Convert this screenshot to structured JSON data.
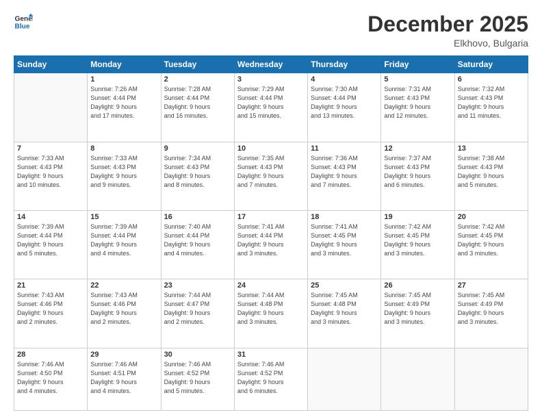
{
  "header": {
    "logo_line1": "General",
    "logo_line2": "Blue",
    "month": "December 2025",
    "location": "Elkhovo, Bulgaria"
  },
  "weekdays": [
    "Sunday",
    "Monday",
    "Tuesday",
    "Wednesday",
    "Thursday",
    "Friday",
    "Saturday"
  ],
  "weeks": [
    [
      {
        "day": "",
        "text": ""
      },
      {
        "day": "1",
        "text": "Sunrise: 7:26 AM\nSunset: 4:44 PM\nDaylight: 9 hours\nand 17 minutes."
      },
      {
        "day": "2",
        "text": "Sunrise: 7:28 AM\nSunset: 4:44 PM\nDaylight: 9 hours\nand 16 minutes."
      },
      {
        "day": "3",
        "text": "Sunrise: 7:29 AM\nSunset: 4:44 PM\nDaylight: 9 hours\nand 15 minutes."
      },
      {
        "day": "4",
        "text": "Sunrise: 7:30 AM\nSunset: 4:44 PM\nDaylight: 9 hours\nand 13 minutes."
      },
      {
        "day": "5",
        "text": "Sunrise: 7:31 AM\nSunset: 4:43 PM\nDaylight: 9 hours\nand 12 minutes."
      },
      {
        "day": "6",
        "text": "Sunrise: 7:32 AM\nSunset: 4:43 PM\nDaylight: 9 hours\nand 11 minutes."
      }
    ],
    [
      {
        "day": "7",
        "text": "Sunrise: 7:33 AM\nSunset: 4:43 PM\nDaylight: 9 hours\nand 10 minutes."
      },
      {
        "day": "8",
        "text": "Sunrise: 7:33 AM\nSunset: 4:43 PM\nDaylight: 9 hours\nand 9 minutes."
      },
      {
        "day": "9",
        "text": "Sunrise: 7:34 AM\nSunset: 4:43 PM\nDaylight: 9 hours\nand 8 minutes."
      },
      {
        "day": "10",
        "text": "Sunrise: 7:35 AM\nSunset: 4:43 PM\nDaylight: 9 hours\nand 7 minutes."
      },
      {
        "day": "11",
        "text": "Sunrise: 7:36 AM\nSunset: 4:43 PM\nDaylight: 9 hours\nand 7 minutes."
      },
      {
        "day": "12",
        "text": "Sunrise: 7:37 AM\nSunset: 4:43 PM\nDaylight: 9 hours\nand 6 minutes."
      },
      {
        "day": "13",
        "text": "Sunrise: 7:38 AM\nSunset: 4:43 PM\nDaylight: 9 hours\nand 5 minutes."
      }
    ],
    [
      {
        "day": "14",
        "text": "Sunrise: 7:39 AM\nSunset: 4:44 PM\nDaylight: 9 hours\nand 5 minutes."
      },
      {
        "day": "15",
        "text": "Sunrise: 7:39 AM\nSunset: 4:44 PM\nDaylight: 9 hours\nand 4 minutes."
      },
      {
        "day": "16",
        "text": "Sunrise: 7:40 AM\nSunset: 4:44 PM\nDaylight: 9 hours\nand 4 minutes."
      },
      {
        "day": "17",
        "text": "Sunrise: 7:41 AM\nSunset: 4:44 PM\nDaylight: 9 hours\nand 3 minutes."
      },
      {
        "day": "18",
        "text": "Sunrise: 7:41 AM\nSunset: 4:45 PM\nDaylight: 9 hours\nand 3 minutes."
      },
      {
        "day": "19",
        "text": "Sunrise: 7:42 AM\nSunset: 4:45 PM\nDaylight: 9 hours\nand 3 minutes."
      },
      {
        "day": "20",
        "text": "Sunrise: 7:42 AM\nSunset: 4:45 PM\nDaylight: 9 hours\nand 3 minutes."
      }
    ],
    [
      {
        "day": "21",
        "text": "Sunrise: 7:43 AM\nSunset: 4:46 PM\nDaylight: 9 hours\nand 2 minutes."
      },
      {
        "day": "22",
        "text": "Sunrise: 7:43 AM\nSunset: 4:46 PM\nDaylight: 9 hours\nand 2 minutes."
      },
      {
        "day": "23",
        "text": "Sunrise: 7:44 AM\nSunset: 4:47 PM\nDaylight: 9 hours\nand 2 minutes."
      },
      {
        "day": "24",
        "text": "Sunrise: 7:44 AM\nSunset: 4:48 PM\nDaylight: 9 hours\nand 3 minutes."
      },
      {
        "day": "25",
        "text": "Sunrise: 7:45 AM\nSunset: 4:48 PM\nDaylight: 9 hours\nand 3 minutes."
      },
      {
        "day": "26",
        "text": "Sunrise: 7:45 AM\nSunset: 4:49 PM\nDaylight: 9 hours\nand 3 minutes."
      },
      {
        "day": "27",
        "text": "Sunrise: 7:45 AM\nSunset: 4:49 PM\nDaylight: 9 hours\nand 3 minutes."
      }
    ],
    [
      {
        "day": "28",
        "text": "Sunrise: 7:46 AM\nSunset: 4:50 PM\nDaylight: 9 hours\nand 4 minutes."
      },
      {
        "day": "29",
        "text": "Sunrise: 7:46 AM\nSunset: 4:51 PM\nDaylight: 9 hours\nand 4 minutes."
      },
      {
        "day": "30",
        "text": "Sunrise: 7:46 AM\nSunset: 4:52 PM\nDaylight: 9 hours\nand 5 minutes."
      },
      {
        "day": "31",
        "text": "Sunrise: 7:46 AM\nSunset: 4:52 PM\nDaylight: 9 hours\nand 6 minutes."
      },
      {
        "day": "",
        "text": ""
      },
      {
        "day": "",
        "text": ""
      },
      {
        "day": "",
        "text": ""
      }
    ]
  ]
}
